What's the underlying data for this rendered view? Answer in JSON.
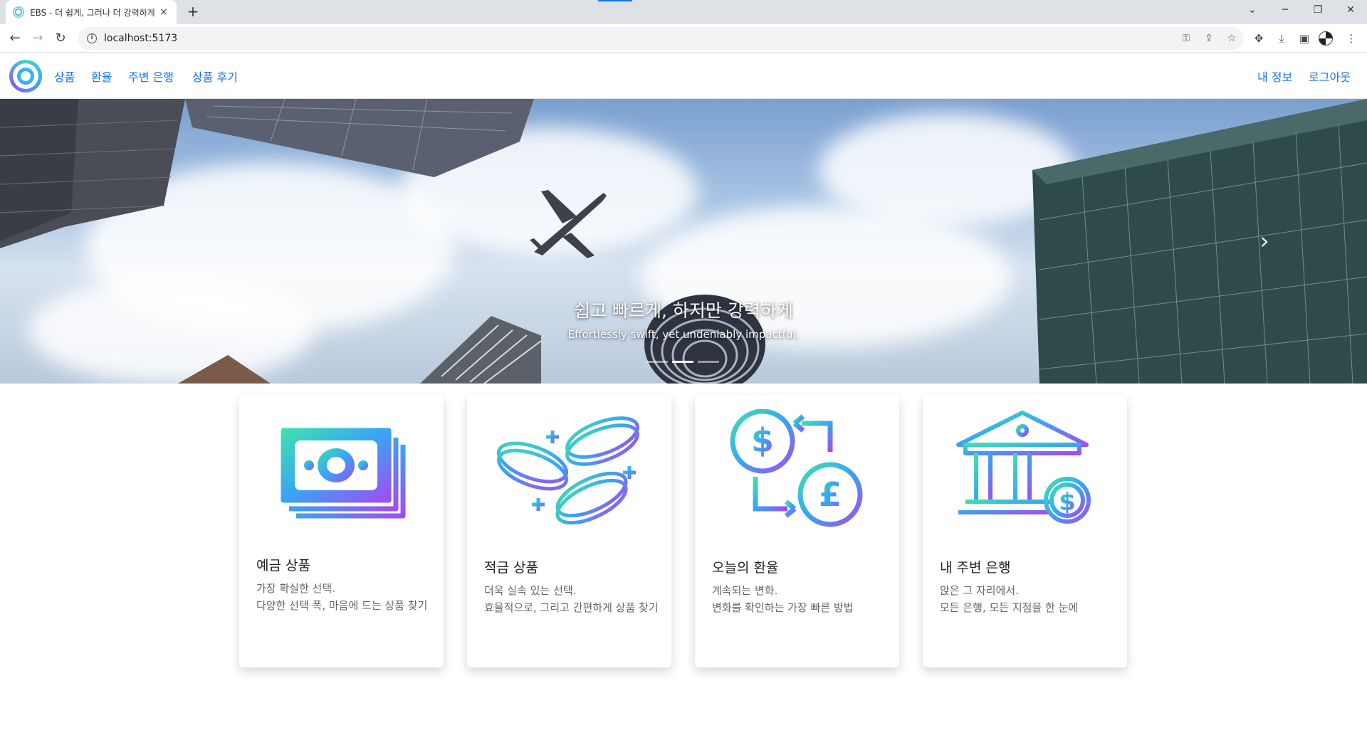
{
  "browser": {
    "tab_title": "EBS - 더 쉽게, 그러나 더 강력하게",
    "tab_close": "×",
    "new_tab": "+",
    "url": "localhost:5173",
    "win_min": "─",
    "win_max": "❐",
    "win_close": "✕",
    "tab_menu": "⌄"
  },
  "nav": {
    "links": [
      "상품",
      "환율",
      "주변 은행",
      "상품 후기"
    ],
    "right": [
      "내 정보",
      "로그아웃"
    ]
  },
  "hero": {
    "title": "쉽고 빠르게, 하지만 강력하게",
    "subtitle": "Effortlessly swift, yet undeniably impactful.",
    "prev": "‹",
    "next": "›",
    "slides": 3,
    "active_slide": 1
  },
  "cards": [
    {
      "title": "예금 상품",
      "line1": "가장 확실한 선택.",
      "line2": "다양한 선택 폭, 마음에 드는 상품 찾기",
      "icon": "banknote-icon"
    },
    {
      "title": "적금 상품",
      "line1": "더욱 실속 있는 선택.",
      "line2": "효율적으로, 그리고 간편하게 상품 찾기",
      "icon": "coins-icon"
    },
    {
      "title": "오늘의 환율",
      "line1": "계속되는 변화.",
      "line2": "변화를 확인하는 가장 빠른 방법",
      "icon": "currency-exchange-icon"
    },
    {
      "title": "내 주변 은행",
      "line1": "앉은 그 자리에서.",
      "line2": "모든 은행, 모든 지점을 한 눈에",
      "icon": "bank-building-icon"
    }
  ],
  "colors": {
    "link": "#1a73e8",
    "gradient_start": "#3fe0b0",
    "gradient_mid": "#3aa3f5",
    "gradient_end": "#9b4df0"
  }
}
